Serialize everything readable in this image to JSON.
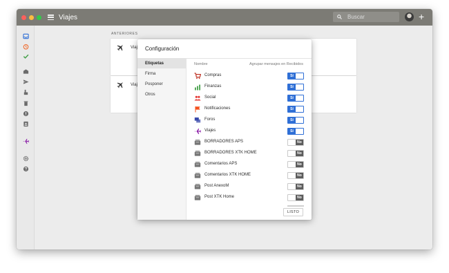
{
  "window": {
    "title": "Viajes"
  },
  "search": {
    "placeholder": "Buscar"
  },
  "inbox": {
    "section_title": "ANTERIORES",
    "cards": [
      {
        "text": "Viaj"
      },
      {
        "text": "Viaj"
      }
    ]
  },
  "settings": {
    "title": "Configuración",
    "nav": [
      "Etiquetas",
      "Firma",
      "Posponer",
      "Otros"
    ],
    "active_nav": "Etiquetas",
    "col_name": "Nombre",
    "col_group": "Agrupar mensajes en Recibidos",
    "rows": [
      {
        "label": "Compras",
        "icon": "cart-icon",
        "color": "#c0392b",
        "toggle": "Sí"
      },
      {
        "label": "Finanzas",
        "icon": "chart-icon",
        "color": "#43a047",
        "toggle": "Sí"
      },
      {
        "label": "Social",
        "icon": "people-icon",
        "color": "#e53935",
        "toggle": "Sí"
      },
      {
        "label": "Notificaciones",
        "icon": "flag-icon",
        "color": "#f4511e",
        "toggle": "Sí"
      },
      {
        "label": "Foros",
        "icon": "forum-icon",
        "color": "#3949ab",
        "toggle": "Sí"
      },
      {
        "label": "Viajes",
        "icon": "plane-icon",
        "color": "#8e24aa",
        "toggle": "Sí"
      },
      {
        "label": "BORRADORES APS",
        "icon": "bundle-icon",
        "color": "#757575",
        "toggle": "No"
      },
      {
        "label": "BORRADORES XTK HOME",
        "icon": "bundle-icon",
        "color": "#757575",
        "toggle": "No"
      },
      {
        "label": "Comentarios APS",
        "icon": "bundle-icon",
        "color": "#757575",
        "toggle": "No"
      },
      {
        "label": "Comentarios XTK HOME",
        "icon": "bundle-icon",
        "color": "#757575",
        "toggle": "No"
      },
      {
        "label": "Post AnexoM",
        "icon": "bundle-icon",
        "color": "#757575",
        "toggle": "No"
      },
      {
        "label": "Post XTK Home",
        "icon": "bundle-icon",
        "color": "#757575",
        "toggle": "No"
      }
    ],
    "done_label": "LISTO"
  },
  "sidebar_icons": [
    "inbox-icon",
    "snooze-icon",
    "done-icon",
    "drafts-icon",
    "sent-icon",
    "reminders-icon",
    "trash-icon",
    "spam-icon",
    "contacts-icon",
    "travel-icon",
    "settings-icon",
    "help-icon"
  ],
  "colors": {
    "titlebar": "#7c7b75",
    "toggle_on": "#2f6fd6",
    "toggle_off": "#5c5c5c",
    "accent_travel": "#8e24aa"
  }
}
